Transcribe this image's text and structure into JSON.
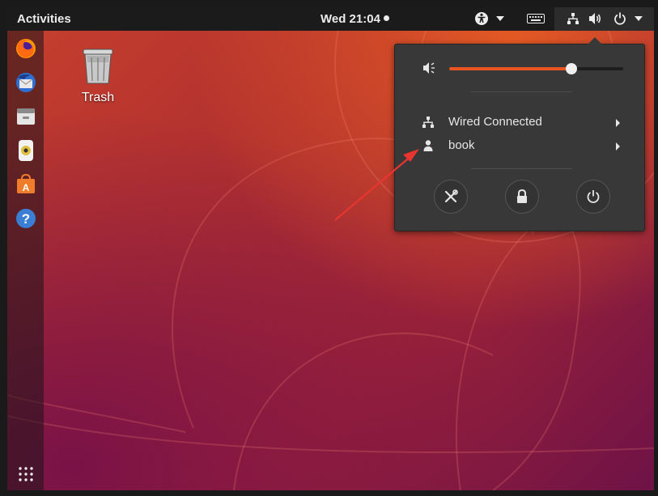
{
  "topbar": {
    "activities_label": "Activities",
    "clock": "Wed 21:04",
    "icons": [
      "accessibility-icon",
      "keyboard-icon",
      "network-icon",
      "volume-icon",
      "power-icon"
    ]
  },
  "dock": {
    "apps": [
      "firefox-icon",
      "thunderbird-icon",
      "files-icon",
      "rhythmbox-icon",
      "software-center-icon",
      "help-icon"
    ],
    "show_apps": "apps-grid-icon"
  },
  "desktop": {
    "trash_label": "Trash"
  },
  "menu": {
    "volume_level": 0.7,
    "network_label": "Wired Connected",
    "user_label": "book",
    "buttons": [
      "settings-icon",
      "lock-icon",
      "power-off-icon"
    ]
  },
  "colors": {
    "accent": "#e95420",
    "panel": "#1b1b1b",
    "menu_bg": "#383838",
    "arrow": "#e8352f"
  }
}
